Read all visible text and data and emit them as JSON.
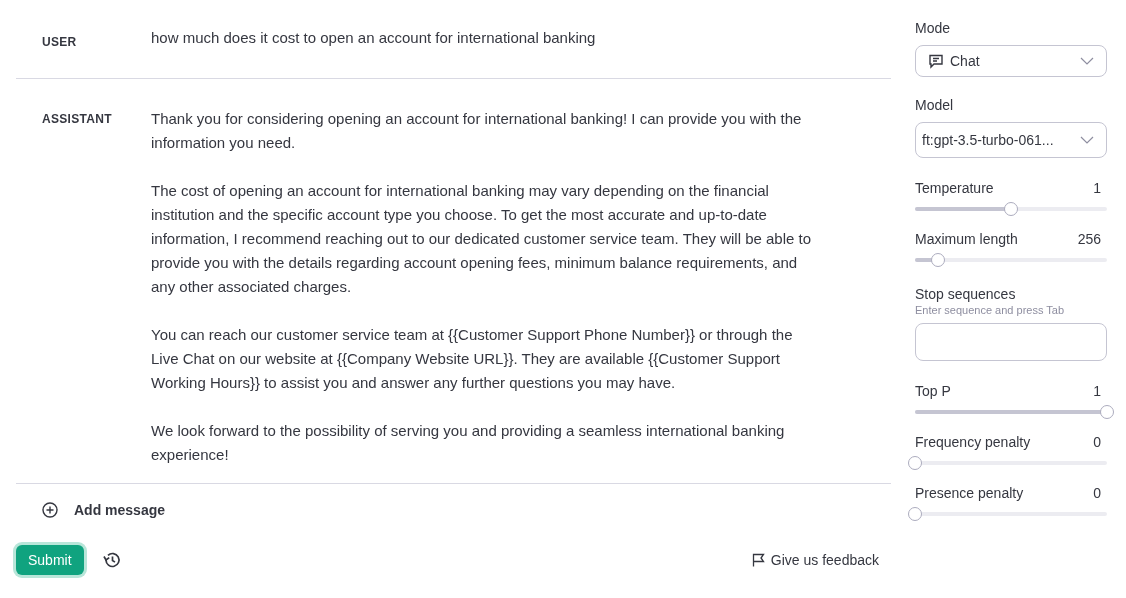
{
  "messages": [
    {
      "role": "USER",
      "paragraphs": [
        "how much does it cost to open an account for international banking"
      ]
    },
    {
      "role": "ASSISTANT",
      "paragraphs": [
        "Thank you for considering opening an account for international banking! I can provide you with the information you need.",
        "The cost of opening an account for international banking may vary depending on the financial institution and the specific account type you choose. To get the most accurate and up-to-date information, I recommend reaching out to our dedicated customer service team. They will be able to provide you with the details regarding account opening fees, minimum balance requirements, and any other associated charges.",
        "You can reach our customer service team at {{Customer Support Phone Number}} or through the Live Chat on our website at {{Company Website URL}}. They are available {{Customer Support Working Hours}} to assist you and answer any further questions you may have.",
        "We look forward to the possibility of serving you and providing a seamless international banking experience!"
      ]
    }
  ],
  "add_message": "Add message",
  "submit": "Submit",
  "feedback": "Give us feedback",
  "settings": {
    "mode": {
      "label": "Mode",
      "value": "Chat"
    },
    "model": {
      "label": "Model",
      "value": "ft:gpt-3.5-turbo-061..."
    },
    "sliders_top": [
      {
        "label": "Temperature",
        "reading": "1",
        "level": 0.5
      },
      {
        "label": "Maximum length",
        "reading": "256",
        "level": 0.12
      }
    ],
    "stop_sequences": {
      "label": "Stop sequences",
      "hint": "Enter sequence and press Tab"
    },
    "sliders_bottom": [
      {
        "label": "Top P",
        "reading": "1",
        "level": 1
      },
      {
        "label": "Frequency penalty",
        "reading": "0",
        "level": 0
      },
      {
        "label": "Presence penalty",
        "reading": "0",
        "level": 0
      }
    ]
  }
}
